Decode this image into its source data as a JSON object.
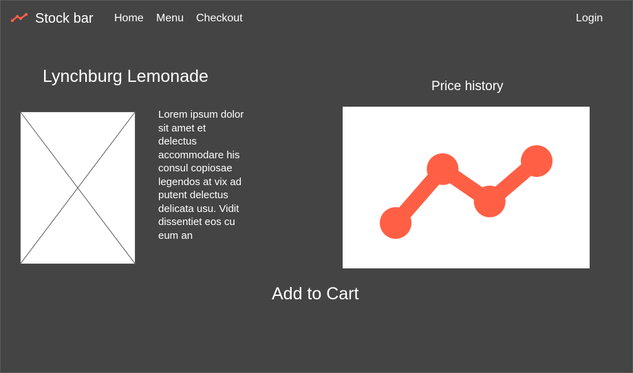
{
  "nav": {
    "brand": "Stock bar",
    "brand_icon": "trend-line-icon",
    "links": [
      "Home",
      "Menu",
      "Checkout"
    ],
    "login": "Login"
  },
  "product": {
    "title": "Lynchburg Lemonade",
    "image_placeholder": "image-placeholder-icon",
    "description": "Lorem ipsum dolor sit amet et delectus accommodare his consul copiosae legendos at vix ad putent delectus delicata usu. Vidit dissentiet eos cu eum an"
  },
  "price_history": {
    "title": "Price history"
  },
  "actions": {
    "add_to_cart": "Add to Cart"
  },
  "colors": {
    "background": "#444444",
    "accent": "#FF5F45",
    "text": "#FFFFFF"
  },
  "chart_data": {
    "type": "line",
    "title": "Price history",
    "x": [
      1,
      2,
      3,
      4
    ],
    "values": [
      1,
      3,
      1.8,
      3.3
    ],
    "xlabel": "",
    "ylabel": "",
    "grid": false
  }
}
